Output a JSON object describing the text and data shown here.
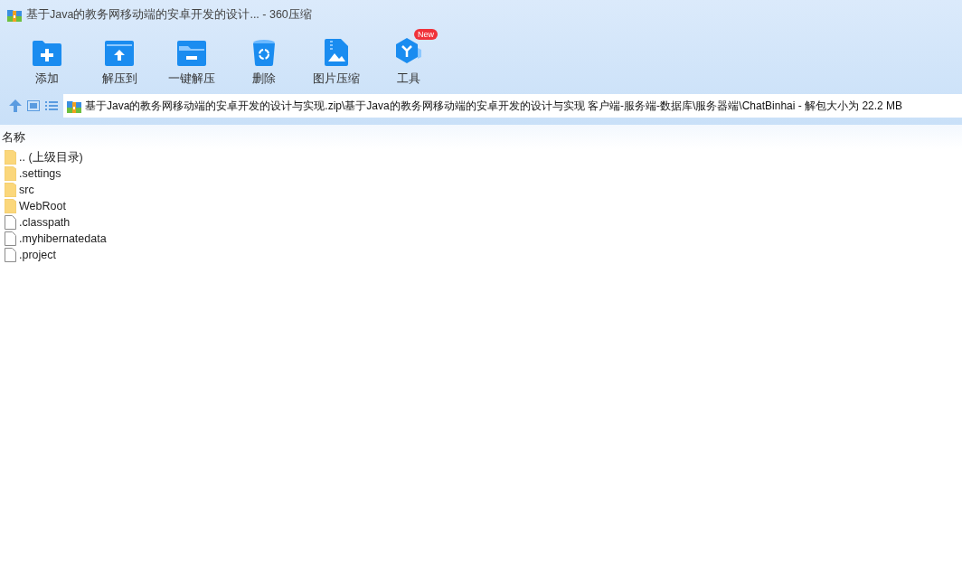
{
  "window": {
    "title": "基于Java的教务网移动端的安卓开发的设计... - 360压缩"
  },
  "toolbar": [
    {
      "label": "添加"
    },
    {
      "label": "解压到"
    },
    {
      "label": "一键解压"
    },
    {
      "label": "删除"
    },
    {
      "label": "图片压缩"
    },
    {
      "label": "工具",
      "badge": "New"
    }
  ],
  "address_bar": {
    "value": "基于Java的教务网移动端的安卓开发的设计与实现.zip\\基于Java的教务网移动端的安卓开发的设计与实现 客户端-服务端-数据库\\服务器端\\ChatBinhai - 解包大小为 22.2 MB"
  },
  "file_list": {
    "columns": [
      "名称"
    ],
    "rows": [
      {
        "name": ".. (上级目录)",
        "kind": "folder"
      },
      {
        "name": ".settings",
        "kind": "folder"
      },
      {
        "name": "src",
        "kind": "folder"
      },
      {
        "name": "WebRoot",
        "kind": "folder"
      },
      {
        "name": ".classpath",
        "kind": "file"
      },
      {
        "name": ".myhibernatedata",
        "kind": "file"
      },
      {
        "name": ".project",
        "kind": "file"
      }
    ]
  }
}
